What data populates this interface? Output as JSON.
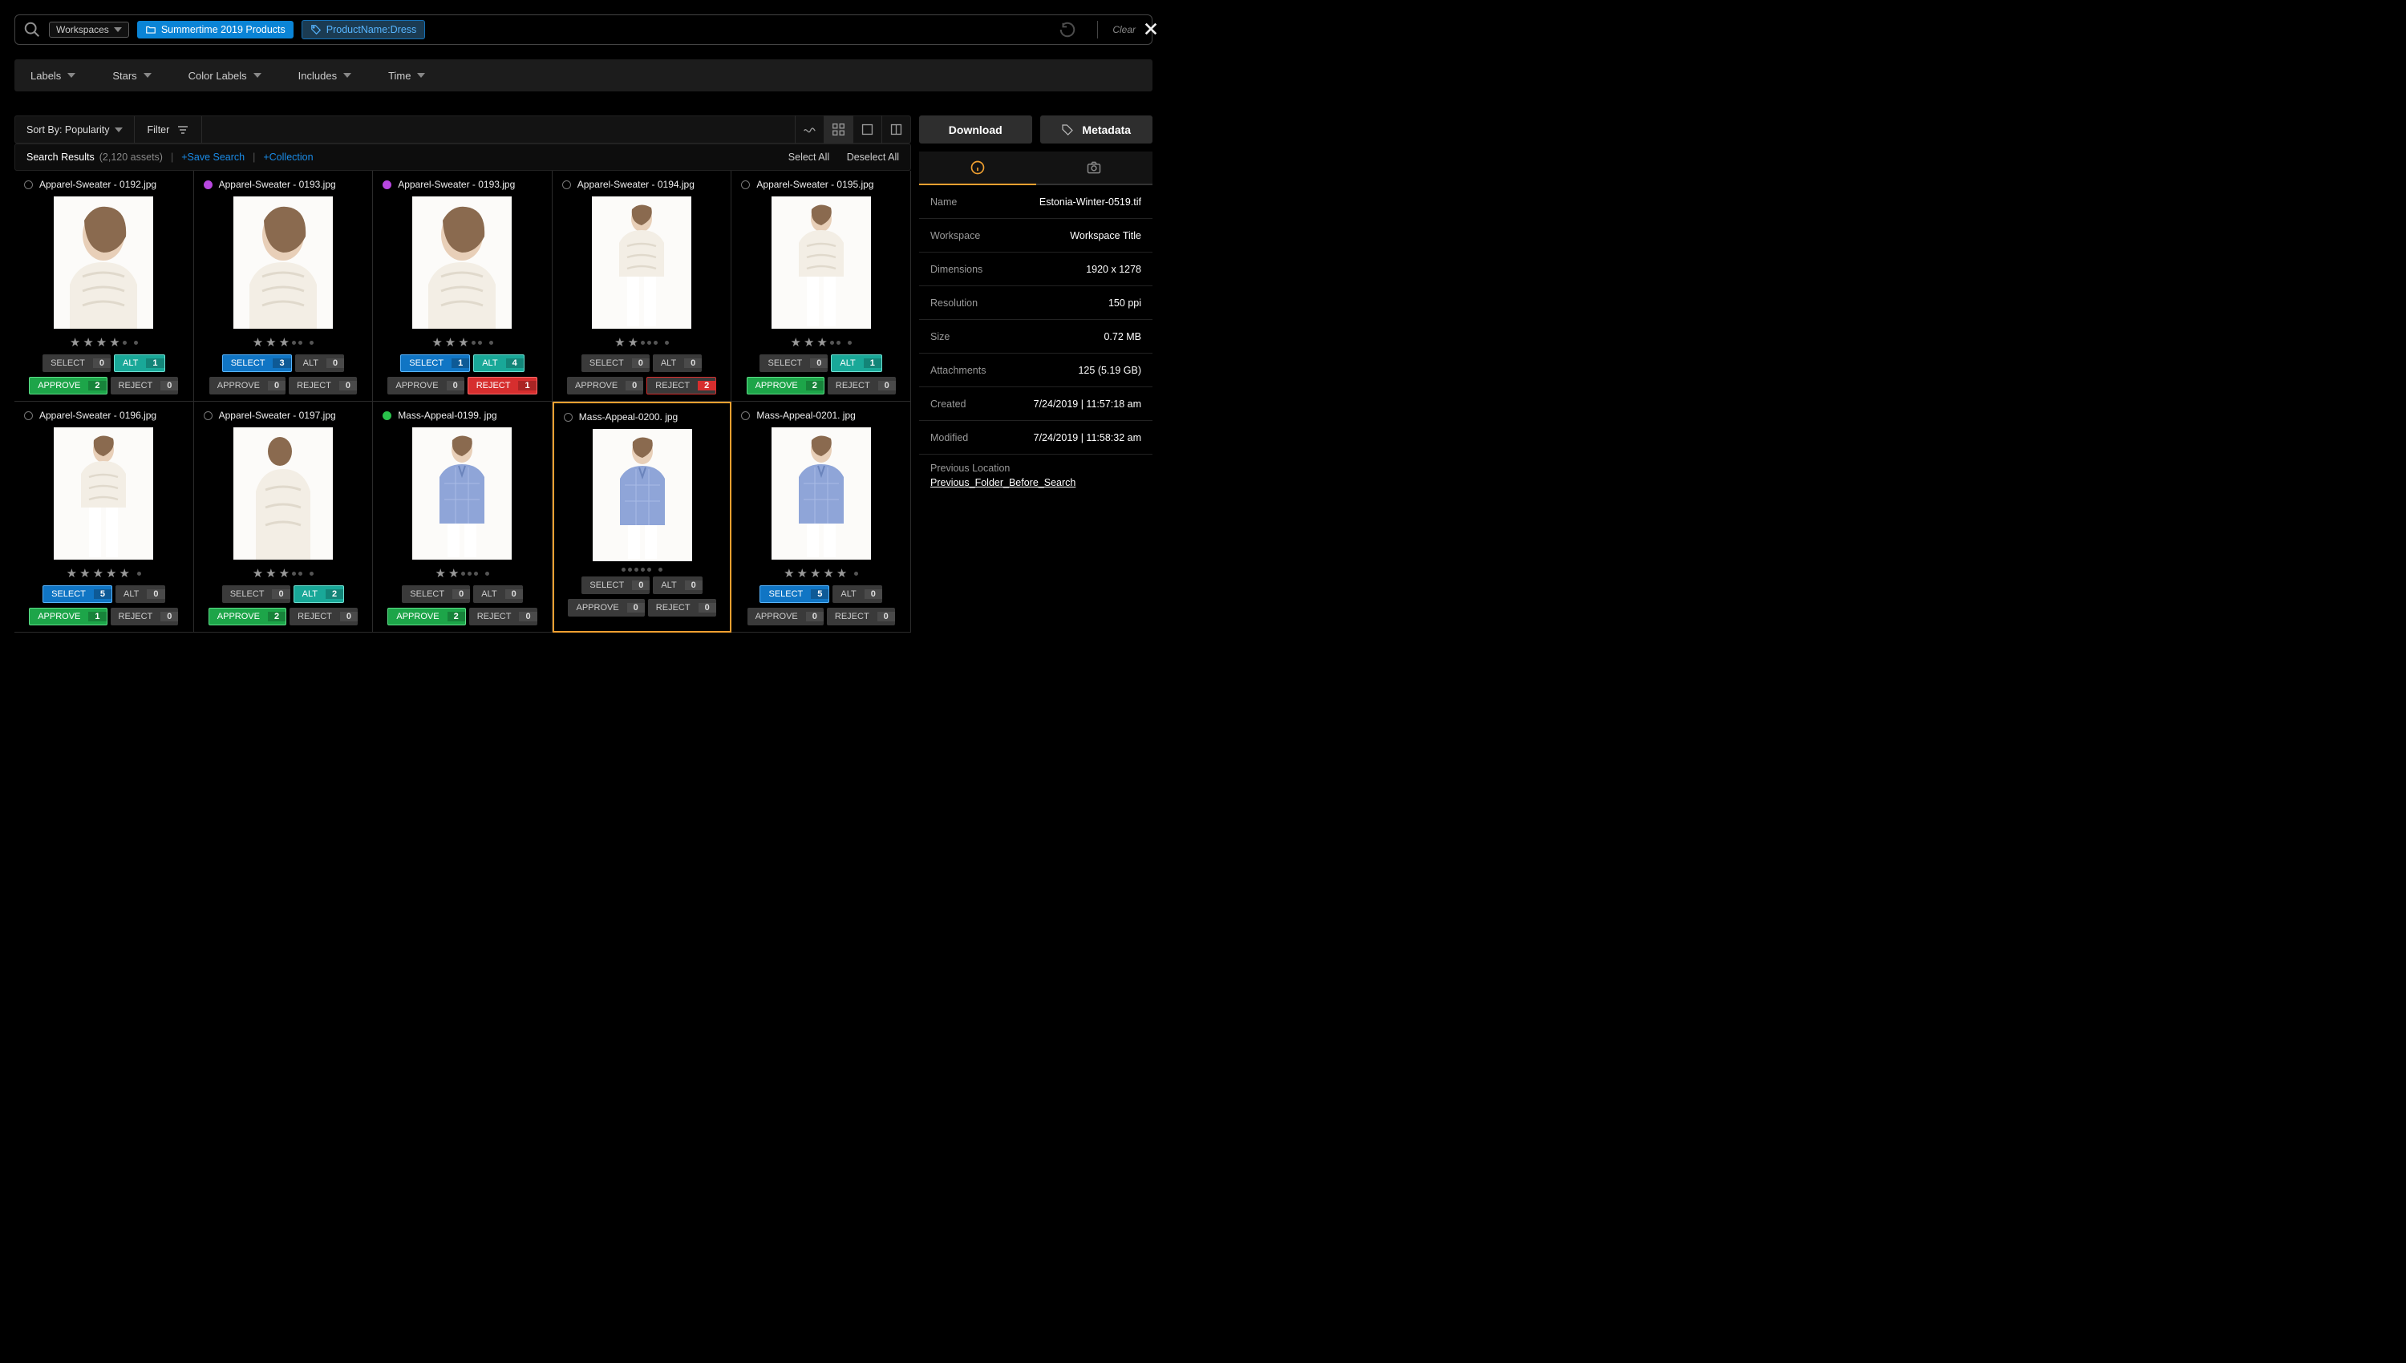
{
  "close": "×",
  "search": {
    "workspaces_label": "Workspaces",
    "chip1": "Summertime 2019 Products",
    "chip2": "ProductName:Dress",
    "clear": "Clear"
  },
  "filters": {
    "labels": "Labels",
    "stars": "Stars",
    "color_labels": "Color Labels",
    "includes": "Includes",
    "time": "Time"
  },
  "controls": {
    "sort_by": "Sort By: Popularity",
    "filter": "Filter"
  },
  "results": {
    "label": "Search Results",
    "count_text": "(2,120 assets)",
    "save_search": "+Save Search",
    "collection": "+Collection",
    "select_all": "Select All",
    "deselect_all": "Deselect All"
  },
  "panel": {
    "download": "Download",
    "metadata": "Metadata",
    "rows": {
      "name": {
        "label": "Name",
        "value": "Estonia-Winter-0519.tif"
      },
      "workspace": {
        "label": "Workspace",
        "value": "Workspace Title"
      },
      "dimensions": {
        "label": "Dimensions",
        "value": "1920 x 1278"
      },
      "resolution": {
        "label": "Resolution",
        "value": "150 ppi"
      },
      "size": {
        "label": "Size",
        "value": "0.72 MB"
      },
      "attachments": {
        "label": "Attachments",
        "value": "125 (5.19 GB)"
      },
      "created": {
        "label": "Created",
        "value": "7/24/2019  |  11:57:18 am"
      },
      "modified": {
        "label": "Modified",
        "value": "7/24/2019  |  11:58:32 am"
      },
      "previous_label": "Previous Location",
      "previous_link": "Previous_Folder_Before_Search"
    }
  },
  "btn_labels": {
    "select": "SELECT",
    "alt": "ALT",
    "approve": "APPROVE",
    "reject": "REJECT"
  },
  "cards": [
    {
      "name": "Apparel-Sweater - 0192.jpg",
      "color": "",
      "stars": 4,
      "img": "sweater-close",
      "select": [
        "gray",
        0
      ],
      "alt": [
        "teal",
        1
      ],
      "approve": [
        "green",
        2
      ],
      "reject": [
        "gray",
        0
      ]
    },
    {
      "name": "Apparel-Sweater - 0193.jpg",
      "color": "purple",
      "stars": 3,
      "img": "sweater-close",
      "select": [
        "blue",
        3
      ],
      "alt": [
        "gray",
        0
      ],
      "approve": [
        "gray",
        0
      ],
      "reject": [
        "gray",
        0
      ]
    },
    {
      "name": "Apparel-Sweater - 0193.jpg",
      "color": "purple",
      "stars": 3,
      "img": "sweater-close",
      "select": [
        "blue",
        1
      ],
      "alt": [
        "teal",
        4
      ],
      "approve": [
        "gray",
        0
      ],
      "reject": [
        "red",
        1
      ]
    },
    {
      "name": "Apparel-Sweater - 0194.jpg",
      "color": "",
      "stars": 2,
      "img": "sweater-full",
      "select": [
        "gray",
        0
      ],
      "alt": [
        "gray",
        0
      ],
      "approve": [
        "gray",
        0
      ],
      "reject": [
        "red-outline",
        2
      ]
    },
    {
      "name": "Apparel-Sweater - 0195.jpg",
      "color": "",
      "stars": 3,
      "img": "sweater-full",
      "select": [
        "gray",
        0
      ],
      "alt": [
        "teal",
        1
      ],
      "approve": [
        "green",
        2
      ],
      "reject": [
        "gray",
        0
      ]
    },
    {
      "name": "Apparel-Sweater - 0196.jpg",
      "color": "",
      "stars": 5,
      "img": "sweater-full",
      "select": [
        "blue",
        5
      ],
      "alt": [
        "gray",
        0
      ],
      "approve": [
        "green",
        1
      ],
      "reject": [
        "gray",
        0
      ]
    },
    {
      "name": "Apparel-Sweater - 0197.jpg",
      "color": "",
      "stars": 3,
      "img": "sweater-back",
      "select": [
        "gray",
        0
      ],
      "alt": [
        "teal",
        2
      ],
      "approve": [
        "green",
        2
      ],
      "reject": [
        "gray",
        0
      ]
    },
    {
      "name": "Mass-Appeal-0199. jpg",
      "color": "green",
      "stars": 2,
      "img": "shirt",
      "select": [
        "gray",
        0
      ],
      "alt": [
        "gray",
        0
      ],
      "approve": [
        "green",
        2
      ],
      "reject": [
        "gray",
        0
      ]
    },
    {
      "name": "Mass-Appeal-0200. jpg",
      "color": "",
      "stars": 0,
      "img": "shirt",
      "selected": true,
      "select": [
        "gray",
        0
      ],
      "alt": [
        "gray",
        0
      ],
      "approve": [
        "gray",
        0
      ],
      "reject": [
        "gray",
        0
      ]
    },
    {
      "name": "Mass-Appeal-0201. jpg",
      "color": "",
      "stars": 5,
      "img": "shirt",
      "select": [
        "blue",
        5
      ],
      "alt": [
        "gray",
        0
      ],
      "approve": [
        "gray",
        0
      ],
      "reject": [
        "gray",
        0
      ]
    }
  ]
}
